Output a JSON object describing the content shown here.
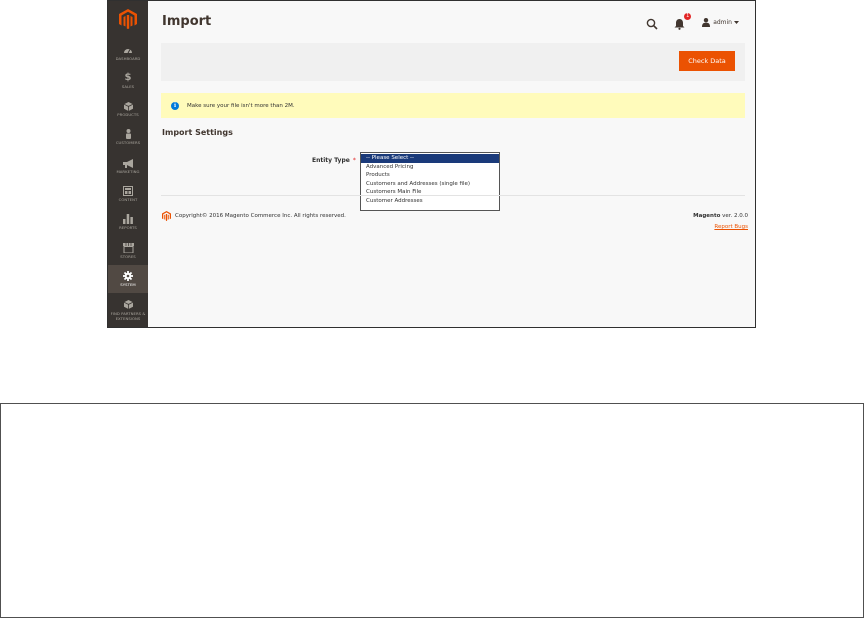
{
  "sidebar": {
    "items": [
      {
        "label": "DASHBOARD",
        "icon": "dashboard-icon"
      },
      {
        "label": "SALES",
        "icon": "dollar-icon",
        "glyph": "$"
      },
      {
        "label": "PRODUCTS",
        "icon": "cube-icon"
      },
      {
        "label": "CUSTOMERS",
        "icon": "person-icon"
      },
      {
        "label": "MARKETING",
        "icon": "megaphone-icon"
      },
      {
        "label": "CONTENT",
        "icon": "content-icon"
      },
      {
        "label": "REPORTS",
        "icon": "bar-chart-icon"
      },
      {
        "label": "STORES",
        "icon": "store-icon"
      },
      {
        "label": "SYSTEM",
        "icon": "gear-icon",
        "active": true
      },
      {
        "label": "FIND PARTNERS & EXTENSIONS",
        "icon": "partners-icon"
      }
    ]
  },
  "header": {
    "title": "Import",
    "user": "admin",
    "notification_count": "1"
  },
  "toolbar": {
    "check_data_label": "Check Data"
  },
  "notice": {
    "text": "Make sure your file isn't more than 2M."
  },
  "section": {
    "title": "Import Settings"
  },
  "form": {
    "entity_type_label": "Entity Type",
    "required_mark": "*",
    "options": [
      "-- Please Select --",
      "Advanced Pricing",
      "Products",
      "Customers and Addresses (single file)",
      "Customers Main File",
      "Customer Addresses"
    ],
    "selected_index": 0
  },
  "footer": {
    "copyright": "Copyright© 2016 Magento Commerce Inc. All rights reserved.",
    "brand": "Magento",
    "version": "ver. 2.0.0",
    "report_bugs": "Report Bugs"
  },
  "colors": {
    "accent": "#eb5202",
    "sidebar": "#373330",
    "notice": "#fffbbb",
    "selection": "#1a3a7a"
  }
}
